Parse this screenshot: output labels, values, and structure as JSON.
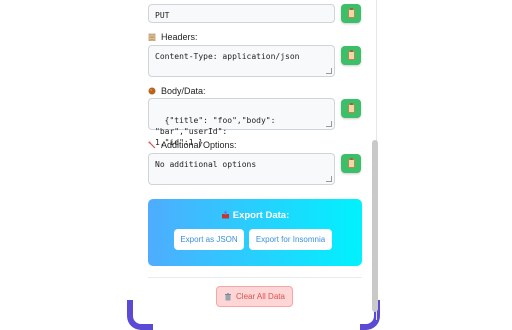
{
  "method_field": {
    "value": "PUT"
  },
  "headers": {
    "label": "Headers:",
    "value": "Content-Type: application/json"
  },
  "body": {
    "label": "Body/Data:",
    "value": "{\"title\": \"foo\",\"body\": \"bar\",\"userId\":\n1,\"id\":1 }"
  },
  "options": {
    "label": "Additional Options:",
    "value": "No additional options"
  },
  "export": {
    "title": "Export Data:",
    "json_label": "Export as JSON",
    "insomnia_label": "Export for Insomnia"
  },
  "clear": {
    "label": "Clear All Data"
  },
  "colors": {
    "copy_button": "#3cbf68",
    "export_gradient_start": "#4facfe",
    "export_gradient_end": "#00f2fe",
    "clear_button_bg": "#ffd6d6",
    "clear_button_text": "#d9534f"
  },
  "icons": {
    "copy": "clipboard-icon",
    "headers": "clipboard-list-icon",
    "body": "package-icon",
    "options": "wrench-icon",
    "export": "outbox-icon",
    "clear": "trash-icon"
  }
}
